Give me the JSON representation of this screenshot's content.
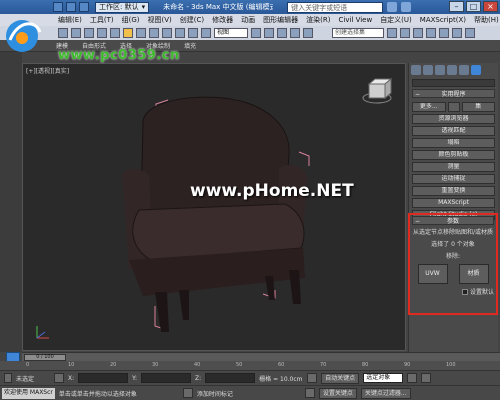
{
  "titlebar": {
    "workspace_label": "工作区: 默认",
    "title": "未命名 - 3ds Max 中文版 (编辑模式)",
    "search_placeholder": "键入关键字或短语"
  },
  "menubar": {
    "items": [
      "编辑(E)",
      "工具(T)",
      "组(G)",
      "视图(V)",
      "创建(C)",
      "修改器",
      "动画",
      "图形编辑器",
      "渲染(R)",
      "Civil View",
      "自定义(U)",
      "MAXScript(X)",
      "帮助(H)"
    ]
  },
  "toolbar": {
    "view_select": "视图",
    "selection_set": "创建选择集"
  },
  "ribbon": {
    "tabs": [
      "建模",
      "自由形式",
      "选择",
      "对象绘制",
      "填充"
    ]
  },
  "viewport": {
    "label": "[+][透视][真实]"
  },
  "watermark": {
    "site": "www.pc0359.cn",
    "center_prefix": "www.p",
    "center_suffix": "Home.NET"
  },
  "command_panel": {
    "utilities_title": "实用程序",
    "more_label": "更多...",
    "sets_label": "集",
    "buttons": [
      "资源浏览器",
      "透视匹配",
      "塌陷",
      "颜色剪贴板",
      "测量",
      "运动捕捉",
      "重置变换",
      "MAXScript",
      "Flight Studio (c)"
    ]
  },
  "params": {
    "title": "参数",
    "desc": "从选定节点移除贴图和/或材质",
    "selected": "选择了 0 个对象",
    "remove_label": "移除:",
    "uvw_btn": "UVW",
    "material_btn": "材质",
    "default_label": "设置默认"
  },
  "timeline": {
    "frame": "0 / 100",
    "ticks": [
      "0",
      "10",
      "20",
      "30",
      "40",
      "50",
      "60",
      "70",
      "80",
      "90",
      "100"
    ]
  },
  "status": {
    "selection": "未选定",
    "x_label": "X:",
    "y_label": "Y:",
    "z_label": "Z:",
    "grid": "栅格 = 10.0cm",
    "auto_key": "自动关键点",
    "selected_obj": "选定对象",
    "set_key": "设置关键点",
    "key_filters": "关键点过滤器...",
    "welcome": "欢迎使用 MAXScr",
    "hint": "单击或单击并拖动以选择对象",
    "add_time_tag": "添加时间标记"
  }
}
